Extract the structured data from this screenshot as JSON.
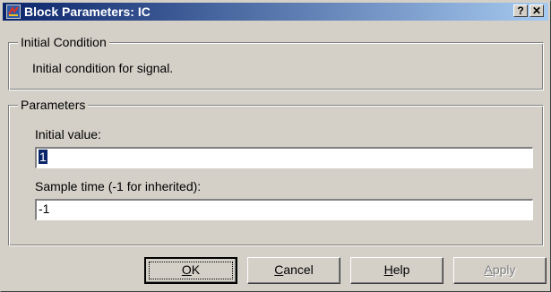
{
  "window": {
    "title": "Block Parameters: IC",
    "help_glyph": "?",
    "close_glyph": "✕"
  },
  "description_group": {
    "label": "Initial Condition",
    "text": "Initial condition for signal."
  },
  "parameters_group": {
    "label": "Parameters",
    "initial_value": {
      "label": "Initial value:",
      "value": "1",
      "selected": true
    },
    "sample_time": {
      "label": "Sample time (-1 for inherited):",
      "value": "-1"
    }
  },
  "buttons": {
    "ok": {
      "mnemonic": "O",
      "rest": "K",
      "enabled": true,
      "default": true
    },
    "cancel": {
      "mnemonic": "C",
      "rest": "ancel",
      "enabled": true
    },
    "help": {
      "mnemonic": "H",
      "rest": "elp",
      "enabled": true
    },
    "apply": {
      "mnemonic": "A",
      "rest": "pply",
      "enabled": false
    }
  },
  "colors": {
    "titlebar_start": "#0a246a",
    "titlebar_end": "#a6caf0",
    "face": "#d4d0c8",
    "selection": "#0a246a"
  }
}
